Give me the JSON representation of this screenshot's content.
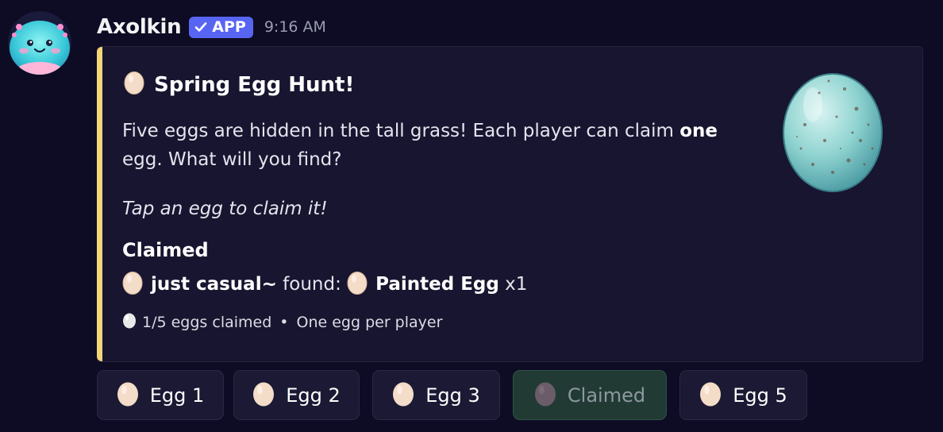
{
  "message": {
    "username": "Axolkin",
    "badge": "APP",
    "timestamp": "9:16 AM"
  },
  "embed": {
    "accent_color": "#f3d57a",
    "title": "Spring Egg Hunt!",
    "description_pre": "Five eggs are hidden in the tall grass! Each player can claim ",
    "description_bold": "one",
    "description_post": " egg. What will you find?",
    "italic_line": "Tap an egg to claim it!",
    "field_name": "Claimed",
    "claim_user": "just casual~",
    "claim_found": " found: ",
    "claim_item": "Painted Egg",
    "claim_qty": " x1",
    "footer_count": "1/5 eggs claimed",
    "footer_sep": "•",
    "footer_rule": "One egg per player"
  },
  "buttons": [
    {
      "label": "Egg 1",
      "icon": "egg-icon",
      "state": "enabled"
    },
    {
      "label": "Egg 2",
      "icon": "egg-icon",
      "state": "enabled"
    },
    {
      "label": "Egg 3",
      "icon": "egg-icon",
      "state": "enabled"
    },
    {
      "label": "Claimed",
      "icon": "egg-icon",
      "state": "disabled"
    },
    {
      "label": "Egg 5",
      "icon": "egg-icon",
      "state": "enabled"
    }
  ]
}
